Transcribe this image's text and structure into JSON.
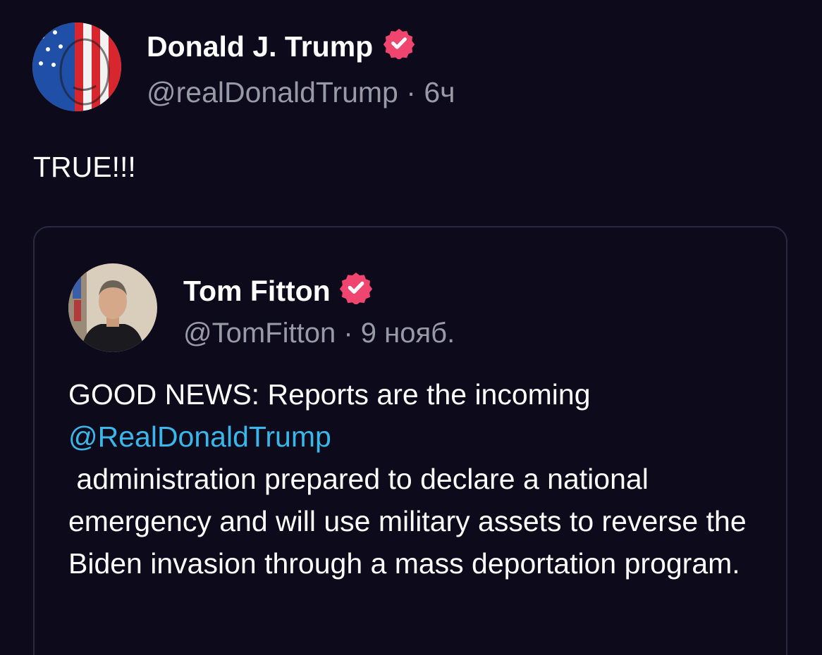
{
  "post": {
    "author_name": "Donald J. Trump",
    "author_handle": "@realDonaldTrump",
    "separator": "·",
    "time": "6ч",
    "verified_icon": "verified-badge-icon",
    "text": "TRUE!!!"
  },
  "quoted_post": {
    "author_name": "Tom Fitton",
    "author_handle": "@TomFitton",
    "separator": "·",
    "time": "9 нояб.",
    "verified_icon": "verified-badge-icon",
    "text_intro": "GOOD NEWS: Reports are the incoming",
    "mention": "@RealDonaldTrump",
    "text_rest": " administration prepared to declare a national emergency and will use military assets to reverse the Biden invasion through a mass deportation program."
  },
  "colors": {
    "background": "#0c0a1b",
    "verified_badge": "#f0456f",
    "mention": "#3ab7e8",
    "handle": "#9a99a6"
  }
}
